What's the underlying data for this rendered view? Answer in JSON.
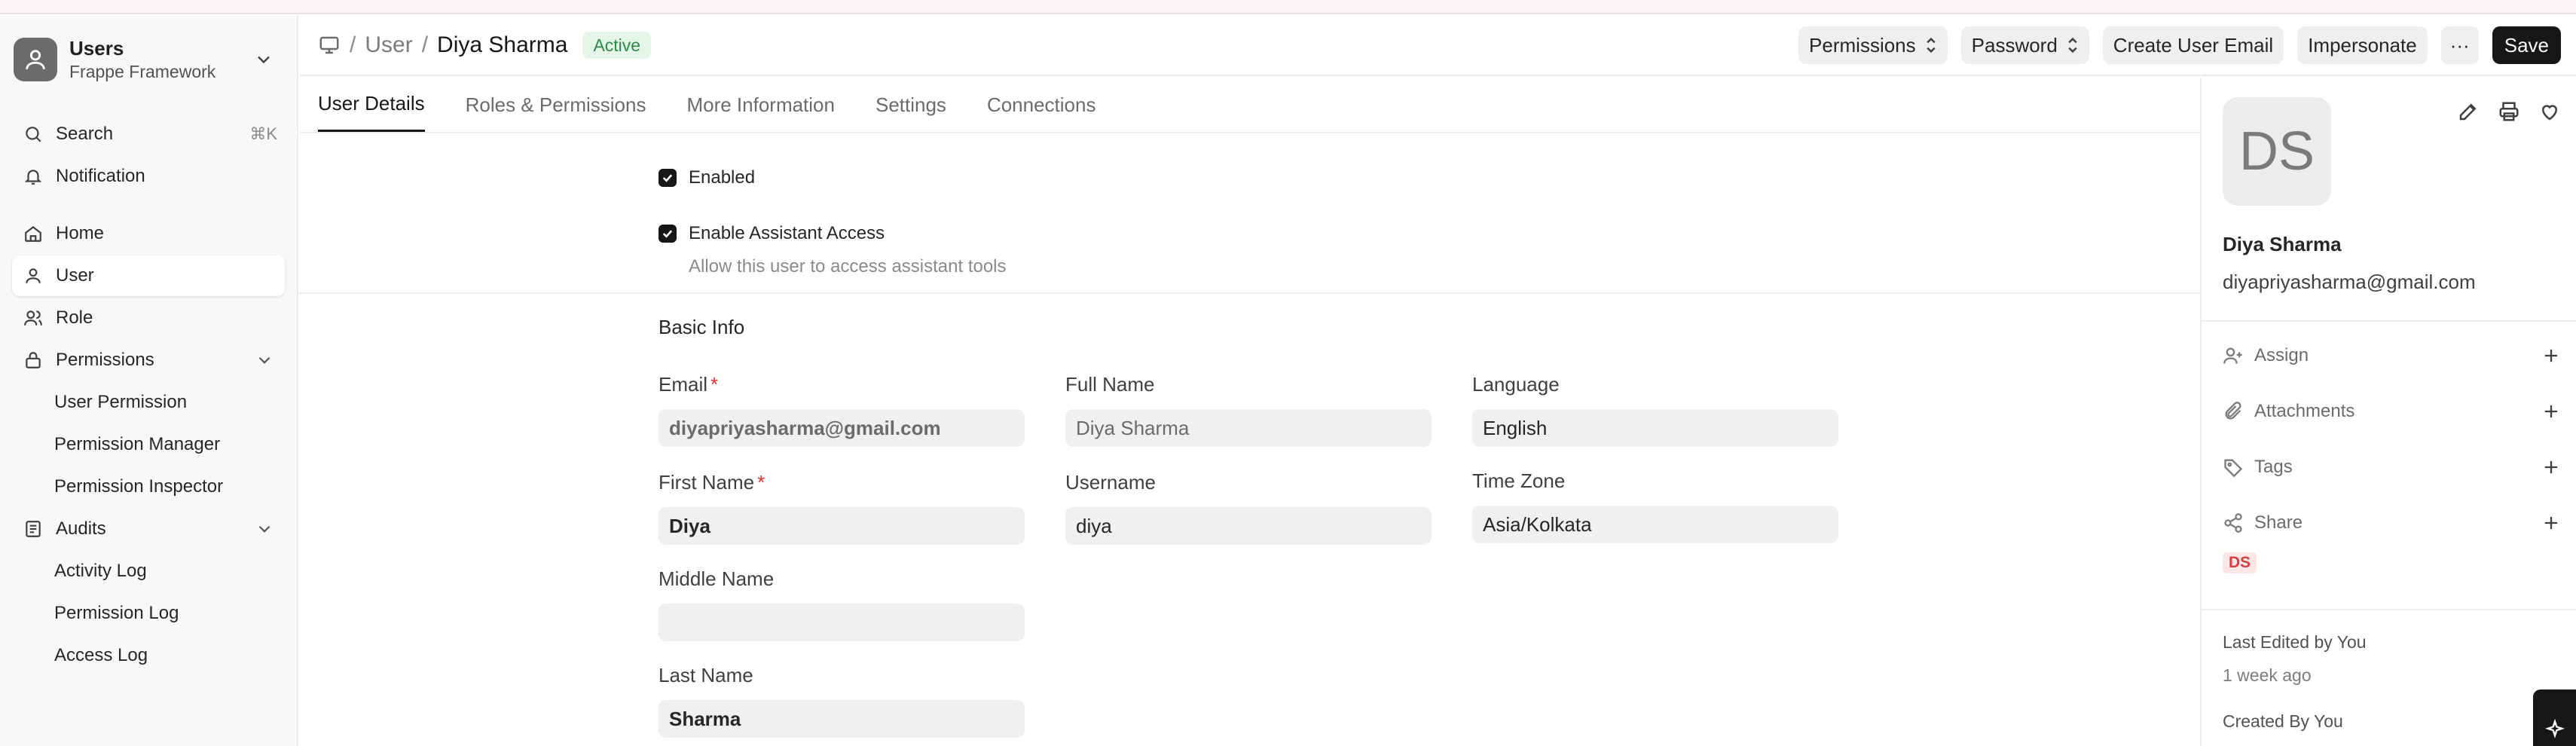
{
  "sidebar": {
    "app_title": "Users",
    "app_subtitle": "Frappe Framework",
    "search_label": "Search",
    "search_shortcut": "⌘K",
    "notification_label": "Notification",
    "items": [
      {
        "label": "Home"
      },
      {
        "label": "User"
      },
      {
        "label": "Role"
      },
      {
        "label": "Permissions"
      },
      {
        "label": "User Permission"
      },
      {
        "label": "Permission Manager"
      },
      {
        "label": "Permission Inspector"
      },
      {
        "label": "Audits"
      },
      {
        "label": "Activity Log"
      },
      {
        "label": "Permission Log"
      },
      {
        "label": "Access Log"
      }
    ]
  },
  "header": {
    "breadcrumb_user": "User",
    "separator": "/",
    "doc_name": "Diya Sharma",
    "status": "Active",
    "permissions_label": "Permissions",
    "password_label": "Password",
    "create_email_label": "Create User Email",
    "impersonate_label": "Impersonate",
    "more_label": "···",
    "save_label": "Save"
  },
  "tabs": [
    {
      "label": "User Details"
    },
    {
      "label": "Roles & Permissions"
    },
    {
      "label": "More Information"
    },
    {
      "label": "Settings"
    },
    {
      "label": "Connections"
    }
  ],
  "form": {
    "enabled_label": "Enabled",
    "assistant_label": "Enable Assistant Access",
    "assistant_desc": "Allow this user to access assistant tools",
    "section_title": "Basic Info",
    "required_mark": "*",
    "email": {
      "label": "Email",
      "value": "diyapriyasharma@gmail.com"
    },
    "full_name": {
      "label": "Full Name",
      "value": "Diya Sharma"
    },
    "language": {
      "label": "Language",
      "value": "English"
    },
    "first_name": {
      "label": "First Name",
      "value": "Diya"
    },
    "username": {
      "label": "Username",
      "value": "diya"
    },
    "time_zone": {
      "label": "Time Zone",
      "value": "Asia/Kolkata"
    },
    "middle_name": {
      "label": "Middle Name",
      "value": ""
    },
    "last_name": {
      "label": "Last Name",
      "value": "Sharma"
    }
  },
  "panel": {
    "avatar_initials": "DS",
    "name": "Diya Sharma",
    "email": "diyapriyasharma@gmail.com",
    "assign_label": "Assign",
    "attachments_label": "Attachments",
    "tags_label": "Tags",
    "share_label": "Share",
    "shared_with": "DS",
    "last_edited": "Last Edited by You",
    "last_edited_time": "1 week ago",
    "created_by": "Created By You"
  },
  "colors": {
    "accent": "#171717",
    "status_bg": "#e3f6e8",
    "status_text": "#2f8a48",
    "required": "#e03636"
  }
}
